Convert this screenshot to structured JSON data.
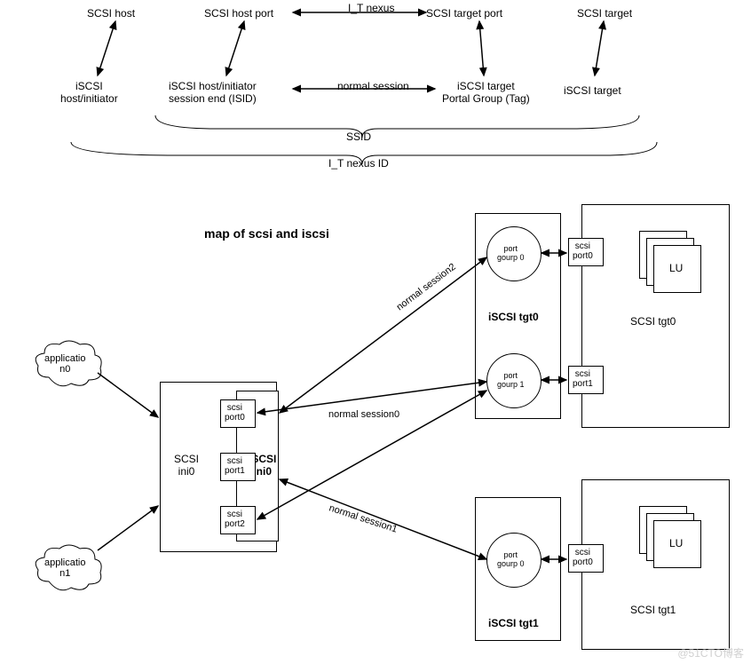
{
  "title": "map of scsi and iscsi",
  "top_labels": {
    "scsi_host": "SCSI host",
    "scsi_host_port": "SCSI host port",
    "it_nexus": "I_T nexus",
    "scsi_target_port": "SCSI target port",
    "scsi_target": "SCSI target",
    "iscsi_host_initiator": "iSCSI\nhost/initiator",
    "iscsi_host_session_end": "iSCSI host/initiator\nsession end (ISID)",
    "normal_session": "normal session",
    "iscsi_target_pg": "iSCSI target\nPortal Group (Tag)",
    "iscsi_target": "iSCSI target",
    "ssid": "SSID",
    "it_nexus_id": "I_T nexus ID"
  },
  "left": {
    "app0": "applicatio\nn0",
    "app1": "applicatio\nn1",
    "scsi_ini0": "SCSI\nini0",
    "iscsi_ini0": "iSCSI\nini0",
    "scsi_port0": "scsi\nport0",
    "scsi_port1": "scsi\nport1",
    "scsi_port2": "scsi\nport2"
  },
  "tgt0": {
    "iscsi_label": "iSCSI tgt0",
    "scsi_label": "SCSI tgt0",
    "lu": "LU",
    "pg0": "port\ngourp 0",
    "pg1": "port\ngourp 1",
    "scsi_port0": "scsi\nport0",
    "scsi_port1": "scsi\nport1"
  },
  "tgt1": {
    "iscsi_label": "iSCSI tgt1",
    "scsi_label": "SCSI tgt1",
    "lu": "LU",
    "pg0": "port\ngourp 0",
    "scsi_port0": "scsi\nport0"
  },
  "sessions": {
    "s0": "normal session0",
    "s1": "normal session1",
    "s2": "normal session2"
  },
  "watermark": "@51CTO博客"
}
